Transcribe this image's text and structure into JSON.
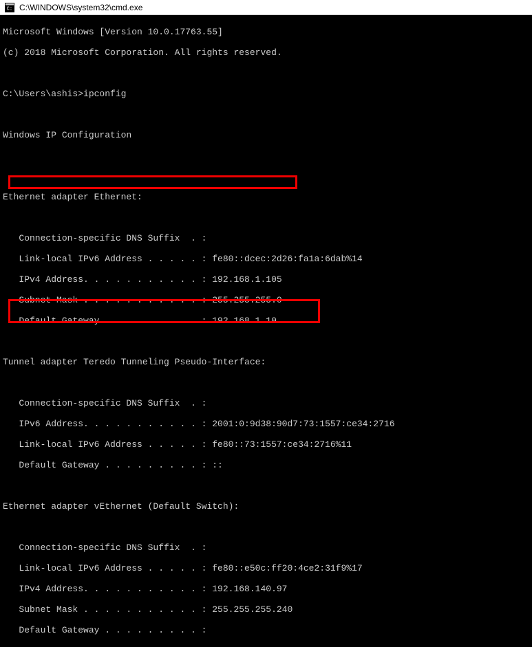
{
  "window": {
    "title": "C:\\WINDOWS\\system32\\cmd.exe"
  },
  "lines": {
    "l0": "Microsoft Windows [Version 10.0.17763.55]",
    "l1": "(c) 2018 Microsoft Corporation. All rights reserved.",
    "l2": "",
    "l3": "C:\\Users\\ashis>ipconfig",
    "l4": "",
    "l5": "Windows IP Configuration",
    "l6": "",
    "l7": "",
    "l8": "Ethernet adapter Ethernet:",
    "l9": "",
    "l10": "   Connection-specific DNS Suffix  . :",
    "l11": "   Link-local IPv6 Address . . . . . : fe80::dcec:2d26:fa1a:6dab%14",
    "l12": "   IPv4 Address. . . . . . . . . . . : 192.168.1.105",
    "l13": "   Subnet Mask . . . . . . . . . . . : 255.255.255.0",
    "l14": "   Default Gateway . . . . . . . . . : 192.168.1.10",
    "l15": "",
    "l16": "Tunnel adapter Teredo Tunneling Pseudo-Interface:",
    "l17": "",
    "l18": "   Connection-specific DNS Suffix  . :",
    "l19": "   IPv6 Address. . . . . . . . . . . : 2001:0:9d38:90d7:73:1557:ce34:2716",
    "l20": "   Link-local IPv6 Address . . . . . : fe80::73:1557:ce34:2716%11",
    "l21": "   Default Gateway . . . . . . . . . : ::",
    "l22": "",
    "l23": "Ethernet adapter vEthernet (Default Switch):",
    "l24": "",
    "l25": "   Connection-specific DNS Suffix  . :",
    "l26": "   Link-local IPv6 Address . . . . . : fe80::e50c:ff20:4ce2:31f9%17",
    "l27": "   IPv4 Address. . . . . . . . . . . : 192.168.140.97",
    "l28": "   Subnet Mask . . . . . . . . . . . : 255.255.255.240",
    "l29": "   Default Gateway . . . . . . . . . :"
  }
}
